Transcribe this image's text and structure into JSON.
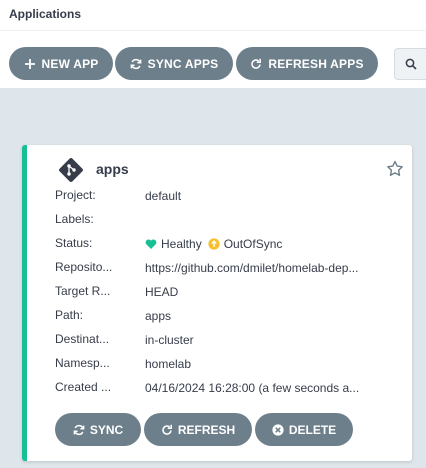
{
  "header": {
    "title": "Applications"
  },
  "toolbar": {
    "new_app": "NEW APP",
    "sync_apps": "SYNC APPS",
    "refresh_apps": "REFRESH APPS"
  },
  "app": {
    "name": "apps",
    "fields": {
      "project": {
        "label": "Project:",
        "value": "default"
      },
      "labels": {
        "label": "Labels:",
        "value": ""
      },
      "status": {
        "label": "Status:",
        "health": "Healthy",
        "sync": "OutOfSync"
      },
      "repository": {
        "label": "Reposito...",
        "value": "https://github.com/dmilet/homelab-dep..."
      },
      "target_revision": {
        "label": "Target R...",
        "value": "HEAD"
      },
      "path": {
        "label": "Path:",
        "value": "apps"
      },
      "destination": {
        "label": "Destinat...",
        "value": "in-cluster"
      },
      "namespace": {
        "label": "Namesp...",
        "value": "homelab"
      },
      "created": {
        "label": "Created ...",
        "value": "04/16/2024 16:28:00  (a few seconds a..."
      }
    },
    "actions": {
      "sync": "SYNC",
      "refresh": "REFRESH",
      "delete": "DELETE"
    }
  },
  "colors": {
    "healthy": "#18be94",
    "out_of_sync": "#f4c030",
    "button": "#6d7f8b",
    "background": "#dee6eb"
  }
}
